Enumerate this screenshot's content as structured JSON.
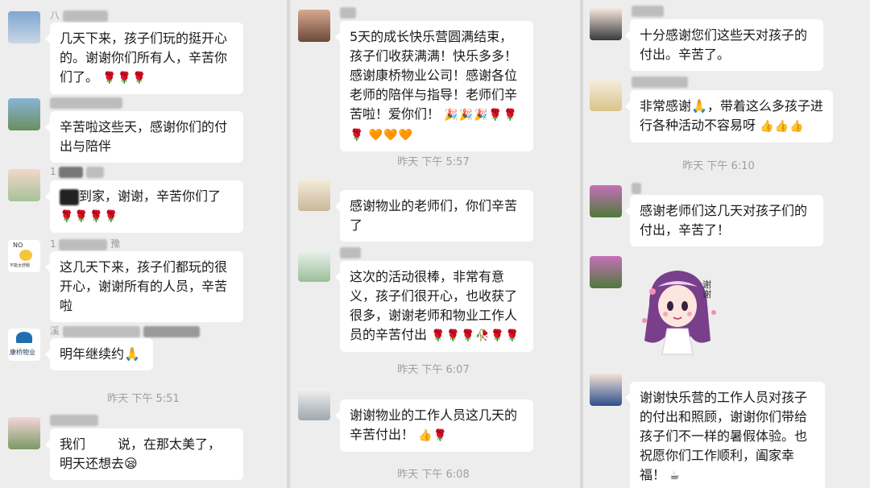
{
  "col1": {
    "m1": {
      "name": "八",
      "text": "几天下来，孩子们玩的挺开心的。谢谢你们所有人，辛苦你们了。",
      "emoji": "🌹🌹🌹"
    },
    "m2": {
      "name": "",
      "text": "辛苦啦这些天，感谢你们的付出与陪伴",
      "emoji": ""
    },
    "m3": {
      "name": "1",
      "text": "到家，谢谢，辛苦你们了",
      "emoji": "🌹🌹🌹🌹"
    },
    "m4": {
      "name": "1",
      "name2": "豫",
      "text": "这几天下来，孩子们都玩的很开心，谢谢所有的人员，辛苦啦",
      "emoji": ""
    },
    "m5": {
      "name": "溪",
      "text": "明年继续约🙏",
      "emoji": ""
    },
    "time": "昨天 下午 5:51",
    "m6": {
      "text_a": "我们",
      "text_b": "说，在那太美了，明天还想去😪",
      "emoji": ""
    },
    "avatar4_label_top": "NO",
    "avatar4_label_bottom": "不能太舒服",
    "avatar5_label": "康桥物业"
  },
  "col2": {
    "m1": {
      "text": "5天的成长快乐营圆满结束，孩子们收获满满！快乐多多！感谢康桥物业公司！感谢各位老师的陪伴与指导！老师们辛苦啦！爱你们！",
      "emoji": "🎉🎉🎉🌹🌹🌹 🧡🧡🧡"
    },
    "time1": "昨天 下午 5:57",
    "m2": {
      "text": "感谢物业的老师们，你们辛苦了",
      "emoji": ""
    },
    "m3": {
      "text": "这次的活动很棒，非常有意义，孩子们很开心，也收获了很多，谢谢老师和物业工作人员的辛苦付出",
      "emoji": "🌹🌹🌹🥀🌹🌹"
    },
    "time2": "昨天 下午 6:07",
    "m4": {
      "text": "谢谢物业的工作人员这几天的辛苦付出！",
      "emoji": "👍🌹"
    },
    "time3": "昨天 下午 6:08"
  },
  "col3": {
    "m1": {
      "text": "十分感谢您们这些天对孩子的付出。辛苦了。",
      "emoji": ""
    },
    "m2": {
      "text": "非常感谢🙏，带着这么多孩子进行各种活动不容易呀",
      "emoji": "👍👍👍"
    },
    "time1": "昨天 下午 6:10",
    "m3": {
      "text": "感谢老师们这几天对孩子们的付出，辛苦了！",
      "emoji": ""
    },
    "sticker_text": "谢谢",
    "m4": {
      "text": "谢谢快乐营的工作人员对孩子的付出和照顾，谢谢你们带给孩子们不一样的暑假体验。也祝愿你们工作顺利，阖家幸福！",
      "emoji": "☕"
    }
  }
}
